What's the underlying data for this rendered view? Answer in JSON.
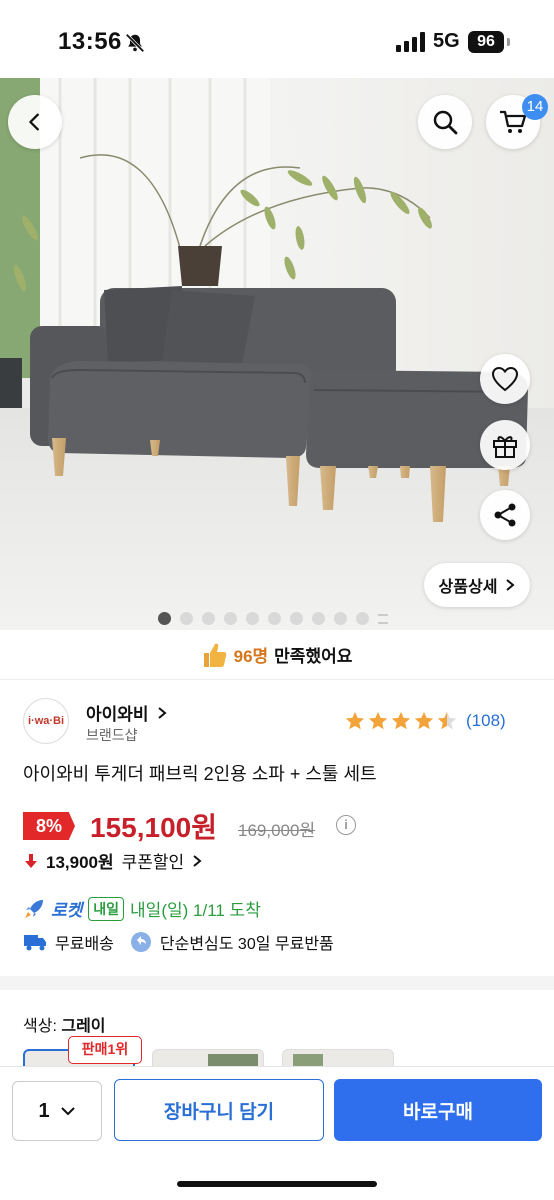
{
  "status_bar": {
    "time": "13:56",
    "network": "5G",
    "battery": "96"
  },
  "header": {
    "cart_count": "14"
  },
  "hero": {
    "detail_button": "상품상세",
    "image_count": 10,
    "active_index": 0
  },
  "satisfaction": {
    "count": "96명",
    "text": "만족했어요"
  },
  "seller": {
    "logo_text": "i·wa·Bi",
    "name": "아이와비",
    "sub": "브랜드샵"
  },
  "rating": {
    "stars": 4.5,
    "count": "(108)"
  },
  "product": {
    "title": "아이와비 투게더 패브릭 2인용 소파 + 스툴 세트"
  },
  "price": {
    "discount": "8%",
    "sale": "155,100원",
    "original": "169,000원",
    "coupon_amount": "13,900원",
    "coupon_label": "쿠폰할인"
  },
  "delivery": {
    "rocket": "로켓",
    "badge": "내일",
    "date": "내일(일) 1/11 도착",
    "free_shipping": "무료배송",
    "return_policy": "단순변심도 30일 무료반품"
  },
  "options": {
    "color_label": "색상:",
    "color_value": "그레이",
    "best_badge": "판매1위"
  },
  "bottom_bar": {
    "quantity": "1",
    "add_to_cart": "장바구니 담기",
    "buy_now": "바로구매"
  },
  "colors": {
    "accent": "#2f6fee",
    "price_red": "#c8202a",
    "discount_red": "#e22828",
    "rocket_green": "#2a9d3f",
    "satisfaction_orange": "#d5761b"
  }
}
